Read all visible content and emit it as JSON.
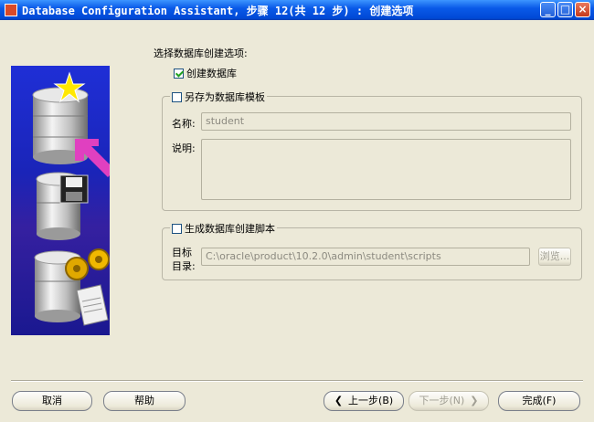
{
  "window": {
    "title": "Database Configuration Assistant, 步骤 12(共 12 步) : 创建选项",
    "minimize": "_",
    "maximize": "□",
    "close": "×"
  },
  "main": {
    "section_label": "选择数据库创建选项:",
    "create_db": {
      "label": "创建数据库",
      "checked": true
    },
    "save_template": {
      "label": "另存为数据库模板",
      "checked": false,
      "name_label": "名称:",
      "name_value": "student",
      "desc_label": "说明:",
      "desc_value": ""
    },
    "gen_scripts": {
      "label": "生成数据库创建脚本",
      "checked": false,
      "dest_label_1": "目标",
      "dest_label_2": "目录:",
      "dest_value": "C:\\oracle\\product\\10.2.0\\admin\\student\\scripts",
      "browse": "浏览..."
    }
  },
  "footer": {
    "cancel": "取消",
    "help": "帮助",
    "back": "上一步(B)",
    "next": "下一步(N)",
    "finish": "完成(F)"
  }
}
